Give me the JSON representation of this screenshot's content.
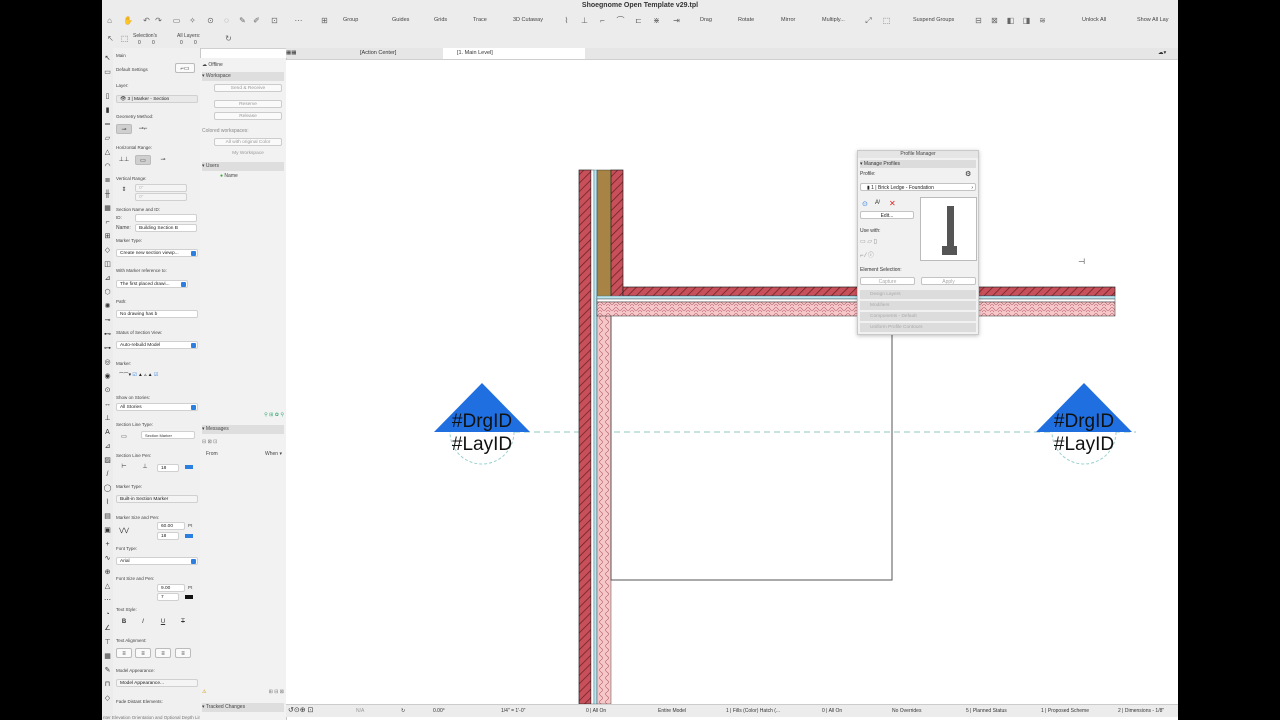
{
  "window": {
    "title": "Shoegnome Open Template v29.tpl"
  },
  "toolbar": {
    "group": "Group",
    "guides": "Guides",
    "grids": "Grids",
    "trace": "Trace",
    "cutaway": "3D Cutaway",
    "drag": "Drag",
    "rotate": "Rotate",
    "mirror": "Mirror",
    "multiply": "Multiply...",
    "suspend_groups": "Suspend Groups",
    "unlock_all": "Unlock All",
    "show_all_layers": "Show All Lay"
  },
  "toolbar2": {
    "selections_label": "Selection's",
    "selections_value": "0",
    "all_layers_label": "All Layers:",
    "all_layers_value": "0"
  },
  "tabs": {
    "action_center": "[Action Center]",
    "main_level": "[1. Main Level]"
  },
  "info_box": {
    "main": "Main",
    "default_settings": "Default Settings",
    "layer_label": "Layer:",
    "layer_value": "3 | Marker - Section",
    "geometry_method": "Geometry Method:",
    "horizontal_range": "Horizontal Range:",
    "vertical_range": "Vertical Range:",
    "section_name_id": "Section Name and ID:",
    "id_label": "ID:",
    "name_label": "Name:",
    "name_value": "Building Section B",
    "marker_type": "Marker Type:",
    "marker_type_value": "Create new section viewp...",
    "marker_ref": "With Marker reference to:",
    "marker_ref_value": "The first placed drawi...",
    "path": "Path:",
    "path_value": "No drawing has b",
    "status": "Status of Section View:",
    "status_value": "Auto-rebuild Model",
    "marker": "Marker:",
    "show_on_stories": "Show on Stories:",
    "show_on_stories_value": "All Stories",
    "section_line_type": "Section Line Type:",
    "section_line_type_value": "Section Marker",
    "section_line_pen": "Section Line Pen:",
    "section_line_pen_value": "18",
    "marker_type2": "Marker Type:",
    "marker_type2_value": "Built-in Section Marker",
    "marker_size_pen": "Marker Size and Pen:",
    "marker_size_value": "60.00",
    "marker_pen_value": "18",
    "pt": "Pt",
    "font_type": "Font Type:",
    "font_value": "Arial",
    "font_size_pen": "Font Size and Pen:",
    "font_size_value": "9.00",
    "font_pen_value": "7",
    "text_style": "Text Style:",
    "text_alignment": "Text Alignment:",
    "model_appearance": "Model Appearance:",
    "model_appearance_value": "Model Appearance...",
    "fade_distant": "Fade Distant Elements:",
    "footer_hint": "nter Elevation Orientation and Optional Depth Limit"
  },
  "navigator": {
    "offline": "Offline",
    "workspace": "Workspace",
    "send_receive": "Send & Receive",
    "reserve": "Reserve",
    "release": "Release",
    "colored_workspaces": "Colored workspaces:",
    "all_with_color": "All with original Color",
    "my_workspace": "My Workspace",
    "users": "Users",
    "name": "Name",
    "messages": "Messages",
    "from": "From",
    "when": "When",
    "tracked_changes": "Tracked Changes"
  },
  "profile_manager": {
    "title": "Profile Manager",
    "manage_profiles": "Manage Profiles",
    "profile_label": "Profile:",
    "profile_value": "1 | Brick Ledge - Foundation",
    "edit": "Edit...",
    "use_with": "Use with:",
    "element_selection": "Element Selection:",
    "capture": "Capture",
    "apply": "Apply",
    "design_layers": "Design Layers",
    "modifiers": "Modifiers",
    "components": "Components - Default",
    "uniform_contours": "Uniform Profile Contours"
  },
  "canvas": {
    "marker_left_line1": "#DrgID",
    "marker_left_line2": "#LayID",
    "marker_right_line1": "#DrgID",
    "marker_right_line2": "#LayID",
    "colors": {
      "brick": "#c8505a",
      "insulation": "#f6c7c9",
      "wood": "#a78445",
      "marker": "#1f6fe0",
      "section_line": "#8fc9c0"
    }
  },
  "statusbar": {
    "zoom": "N/A",
    "angle": "0.00°",
    "scale": "1/4\"   =   1'-0\"",
    "layer_combo": "0 | All On",
    "model_view": "Entire Model",
    "pen_set": "1 | Fills (Color) Hatch (...",
    "layer2": "0 | All On",
    "overrides": "No Overrides",
    "renovation": "5 | Planned Status",
    "structure": "1 | Proposed Scheme",
    "dimensions": "2 | Dimensions - 1/8\""
  }
}
